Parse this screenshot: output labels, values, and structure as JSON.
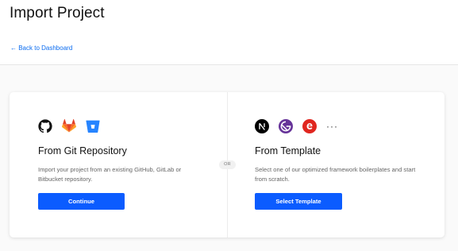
{
  "header": {
    "title": "Import Project",
    "back_link": "← Back to Dashboard"
  },
  "divider_label": "OR",
  "git_panel": {
    "icons": [
      "github-icon",
      "gitlab-icon",
      "bitbucket-icon"
    ],
    "title": "From Git Repository",
    "description": "Import your project from an existing GitHub, GitLab or Bitbucket repository.",
    "button_label": "Continue"
  },
  "template_panel": {
    "icons": [
      "nextjs-icon",
      "gatsby-icon",
      "eleventy-icon",
      "more-icon"
    ],
    "more_label": "···",
    "title": "From Template",
    "description": "Select one of our optimized framework boilerplates and start from scratch.",
    "button_label": "Select Template"
  },
  "colors": {
    "accent": "#0b5cff",
    "link": "#0b6cf0",
    "background": "#fafafa"
  }
}
